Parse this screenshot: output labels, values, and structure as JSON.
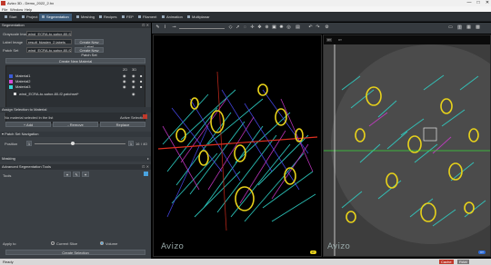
{
  "window": {
    "title": "Avizo 3D - Demo_2022_2.hx",
    "minimize": "—",
    "maximize": "□",
    "close": "✕"
  },
  "menu": [
    "File",
    "Window",
    "Help"
  ],
  "tabs": [
    {
      "label": "Start",
      "active": false
    },
    {
      "label": "Project",
      "active": false
    },
    {
      "label": "Segmentation",
      "active": true
    },
    {
      "label": "Meshing",
      "active": false
    },
    {
      "label": "Recipes",
      "active": false
    },
    {
      "label": "FEP",
      "active": false
    },
    {
      "label": "Filament",
      "active": false
    },
    {
      "label": "Animation",
      "active": false
    },
    {
      "label": "Multiplanar",
      "active": false
    }
  ],
  "segmentation": {
    "header": "Segmentation",
    "grayscale_image_label": "Grayscale Image",
    "grayscale_image_value": "wind_ECRA-to-sahcr-80-f2.am",
    "label_image_label": "Label Image",
    "label_image_value": "result_fdaslen_2.labels",
    "new_label_button": "Create New Label",
    "patch_set_label": "Patch Set",
    "patch_set_value": "wind_ECRA-to-sahcr-80-f2.patch",
    "new_patch_button": "Create New Patch Set",
    "new_material_button": "Create New Material",
    "table_headers": [
      "2D",
      "3D"
    ],
    "materials": [
      {
        "name": "Material1",
        "color": "#3b5bd6"
      },
      {
        "name": "Material2",
        "color": "#d64bd6"
      },
      {
        "name": "Material3",
        "color": "#3ad6d6"
      },
      {
        "name": "wind_ECRA-to-sahcr-80-f2.patchset*",
        "color": "#dddddd"
      }
    ],
    "assign_header": "Assign Selection to Material",
    "no_material": "No material selected in the list",
    "active_selection": "Active Selection",
    "add_label": "+ Add",
    "remove_label": "- Remove",
    "replace_label": "Replace",
    "patch_nav_header": "▾ Patch Set Navigation",
    "position_label": "Position",
    "position_min": "1",
    "position_max": "1",
    "position_current": "16",
    "position_total": "/ 40",
    "masking_label": "Masking",
    "tools_header": "Advanced Segmentation Tools",
    "tools_label": "Tools",
    "apply_to": "Apply to",
    "current_slice": "Current Slice",
    "volume": "Volume",
    "create_selection": "Create Selection"
  },
  "viewers": {
    "view3d_watermark": "Avizo",
    "view2d_watermark": "Avizo",
    "view2d_tag": "XY",
    "view2d_axis": "XY",
    "scale3d": "0°",
    "scale2d": "XY"
  },
  "status": {
    "left": "Ready",
    "middle": "Cache",
    "right": "RAM"
  },
  "colors": {
    "accent": "#3c5a78",
    "fiber_cyan": "#2fd3c8",
    "fiber_yellow": "#e8d21a",
    "fiber_magenta": "#d03ad0",
    "fiber_blue": "#4a4af0",
    "fiber_red": "#e03020"
  }
}
